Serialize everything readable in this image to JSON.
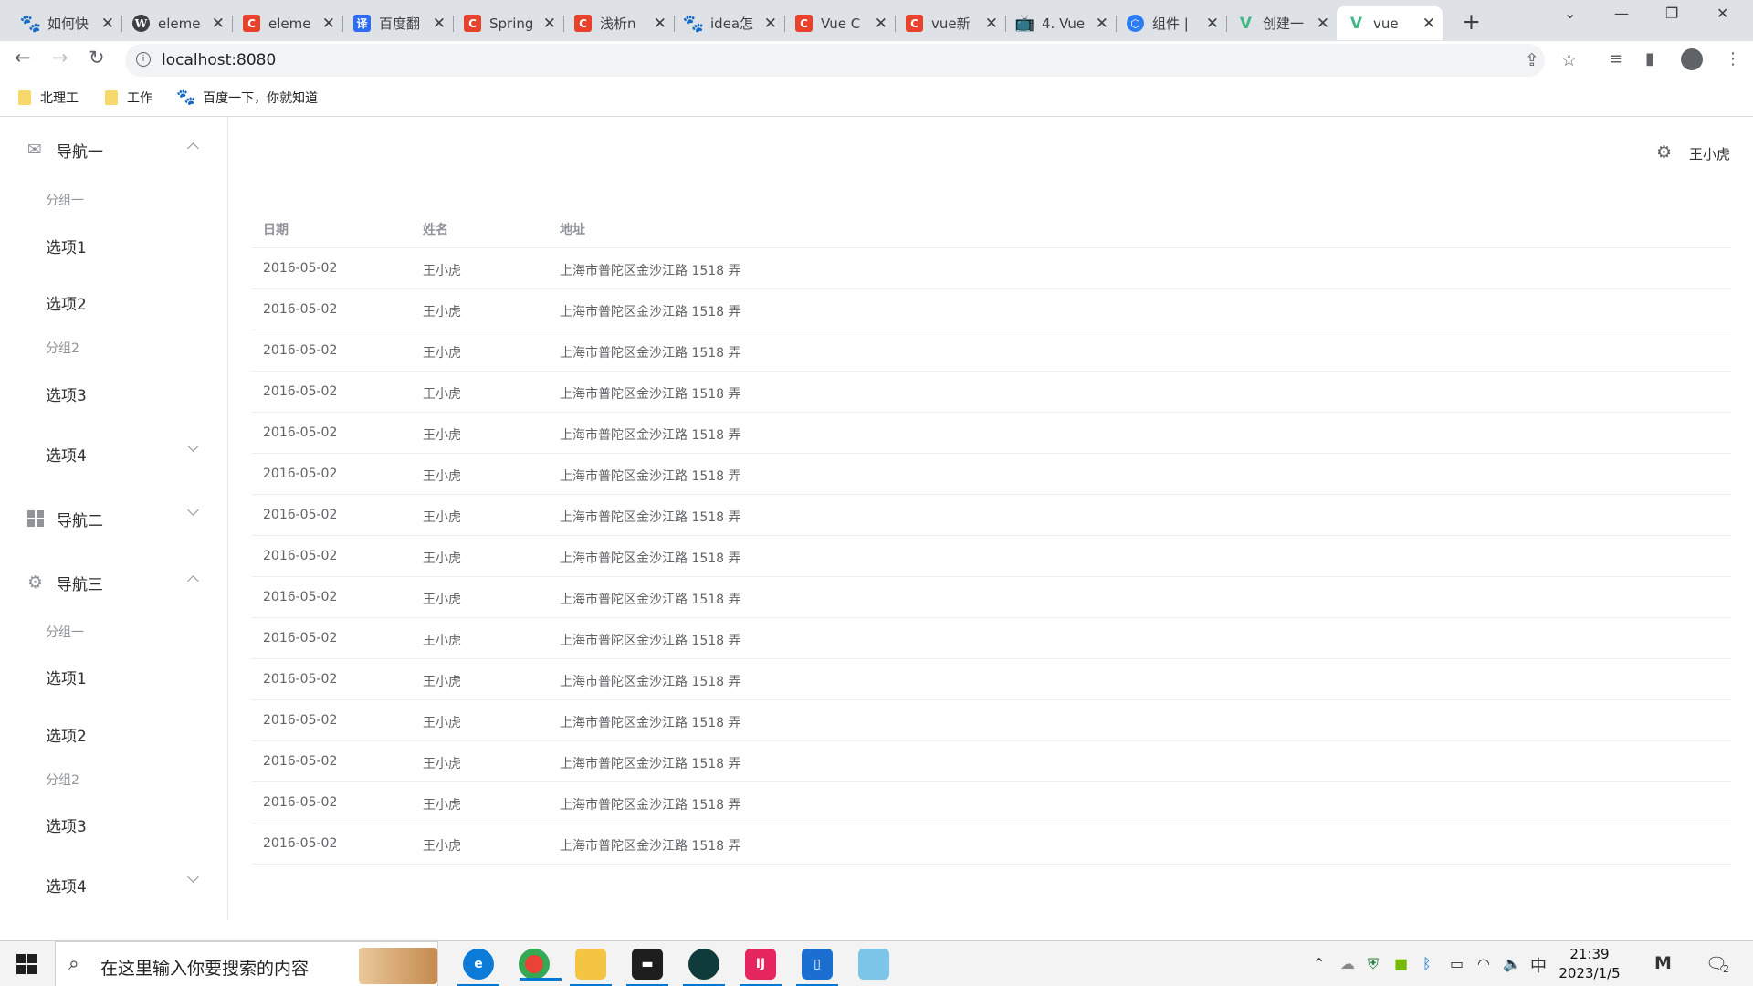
{
  "browser": {
    "tabs": [
      {
        "title": "如何快",
        "favicon": "baidu-paw"
      },
      {
        "title": "eleme",
        "favicon": "wordpress"
      },
      {
        "title": "eleme",
        "favicon": "csdn"
      },
      {
        "title": "百度翻",
        "favicon": "baidu-translate"
      },
      {
        "title": "Spring",
        "favicon": "csdn"
      },
      {
        "title": "浅析n",
        "favicon": "csdn"
      },
      {
        "title": "idea怎",
        "favicon": "baidu-paw"
      },
      {
        "title": "Vue C",
        "favicon": "csdn"
      },
      {
        "title": "vue新",
        "favicon": "csdn"
      },
      {
        "title": "4. Vue",
        "favicon": "bilibili"
      },
      {
        "title": "组件 |",
        "favicon": "element"
      },
      {
        "title": "创建一",
        "favicon": "vue"
      },
      {
        "title": "vue",
        "favicon": "vue"
      }
    ],
    "address": "localhost:8080",
    "bookmarks": [
      {
        "label": "北理工",
        "icon": "folder"
      },
      {
        "label": "工作",
        "icon": "folder"
      },
      {
        "label": "百度一下，你就知道",
        "icon": "baidu-paw"
      }
    ]
  },
  "sidebar": {
    "nav1": {
      "label": "导航一",
      "icon": "mail-icon",
      "expanded": true
    },
    "nav1_group1": "分组一",
    "nav1_opt1": "选项1",
    "nav1_opt2": "选项2",
    "nav1_group2": "分组2",
    "nav1_opt3": "选项3",
    "nav1_opt4": "选项4",
    "nav2": {
      "label": "导航二",
      "icon": "grid-icon",
      "expanded": false
    },
    "nav3": {
      "label": "导航三",
      "icon": "settings-icon",
      "expanded": true
    },
    "nav3_group1": "分组一",
    "nav3_opt1": "选项1",
    "nav3_opt2": "选项2",
    "nav3_group2": "分组2",
    "nav3_opt3": "选项3",
    "nav3_opt4": "选项4"
  },
  "header": {
    "user": "王小虎"
  },
  "table": {
    "columns": [
      "日期",
      "姓名",
      "地址"
    ],
    "rows": [
      [
        "2016-05-02",
        "王小虎",
        "上海市普陀区金沙江路 1518 弄"
      ],
      [
        "2016-05-02",
        "王小虎",
        "上海市普陀区金沙江路 1518 弄"
      ],
      [
        "2016-05-02",
        "王小虎",
        "上海市普陀区金沙江路 1518 弄"
      ],
      [
        "2016-05-02",
        "王小虎",
        "上海市普陀区金沙江路 1518 弄"
      ],
      [
        "2016-05-02",
        "王小虎",
        "上海市普陀区金沙江路 1518 弄"
      ],
      [
        "2016-05-02",
        "王小虎",
        "上海市普陀区金沙江路 1518 弄"
      ],
      [
        "2016-05-02",
        "王小虎",
        "上海市普陀区金沙江路 1518 弄"
      ],
      [
        "2016-05-02",
        "王小虎",
        "上海市普陀区金沙江路 1518 弄"
      ],
      [
        "2016-05-02",
        "王小虎",
        "上海市普陀区金沙江路 1518 弄"
      ],
      [
        "2016-05-02",
        "王小虎",
        "上海市普陀区金沙江路 1518 弄"
      ],
      [
        "2016-05-02",
        "王小虎",
        "上海市普陀区金沙江路 1518 弄"
      ],
      [
        "2016-05-02",
        "王小虎",
        "上海市普陀区金沙江路 1518 弄"
      ],
      [
        "2016-05-02",
        "王小虎",
        "上海市普陀区金沙江路 1518 弄"
      ],
      [
        "2016-05-02",
        "王小虎",
        "上海市普陀区金沙江路 1518 弄"
      ],
      [
        "2016-05-02",
        "王小虎",
        "上海市普陀区金沙江路 1518 弄"
      ]
    ]
  },
  "taskbar": {
    "search_placeholder": "在这里输入你要搜索的内容",
    "ime": "中",
    "time": "21:39",
    "date": "2023/1/5",
    "notifications": "2"
  },
  "colors": {
    "accent": "#409eff",
    "vue": "#41b883",
    "csdn": "#e8412c"
  }
}
